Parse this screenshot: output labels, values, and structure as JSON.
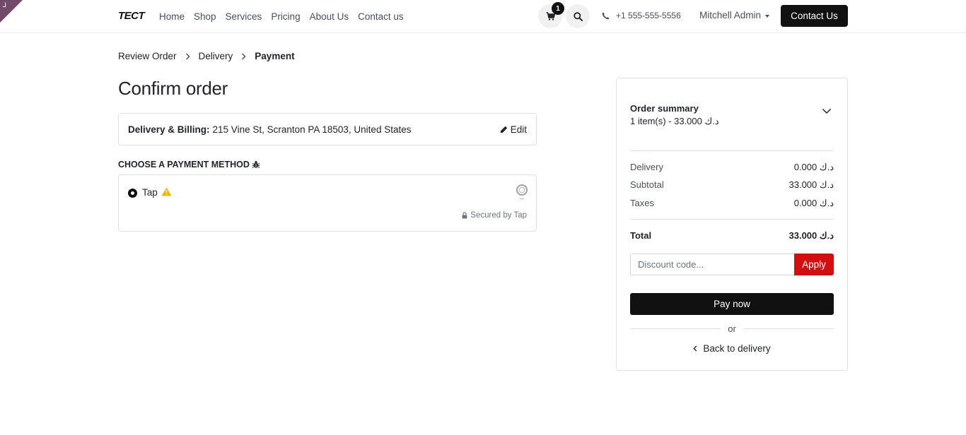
{
  "header": {
    "logo": "TECT",
    "nav": [
      "Home",
      "Shop",
      "Services",
      "Pricing",
      "About Us",
      "Contact us"
    ],
    "cart_count": "1",
    "phone": "+1 555-555-5556",
    "user": "Mitchell Admin",
    "contact_button": "Contact Us"
  },
  "breadcrumb": {
    "steps": [
      "Review Order",
      "Delivery",
      "Payment"
    ]
  },
  "page_title": "Confirm order",
  "address": {
    "label": "Delivery & Billing:",
    "value": "215 Vine St, Scranton PA 18503, United States",
    "edit_label": "Edit"
  },
  "payment": {
    "heading": "CHOOSE A PAYMENT METHOD",
    "method_label": "Tap",
    "secured_label": "Secured by Tap"
  },
  "summary": {
    "title": "Order summary",
    "items_line": "1 item(s) -  33.000  د.ك",
    "delivery_label": "Delivery",
    "delivery_value": "0.000  د.ك",
    "subtotal_label": "Subtotal",
    "subtotal_value": "33.000  د.ك",
    "taxes_label": "Taxes",
    "taxes_value": "0.000  د.ك",
    "total_label": "Total",
    "total_value": "33.000  د.ك",
    "discount_placeholder": "Discount code...",
    "apply_label": "Apply",
    "pay_label": "Pay now",
    "or_label": "or",
    "back_label": "Back to delivery"
  },
  "colors": {
    "brand_corner": "#714b67",
    "apply_button": "#d10f0f",
    "primary_button": "#111111",
    "warning": "#f0b400"
  }
}
